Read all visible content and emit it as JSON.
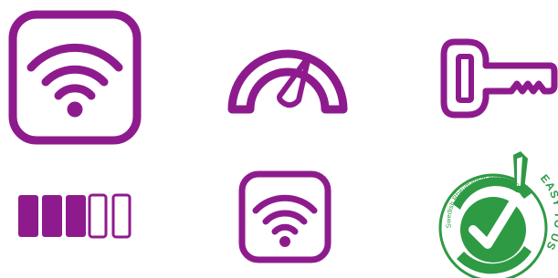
{
  "colors": {
    "primary": "#8e1b8e",
    "badge_green": "#2e9a44",
    "background": "#ffffff"
  },
  "icons": [
    {
      "name": "wifi-large-icon"
    },
    {
      "name": "speedometer-icon"
    },
    {
      "name": "key-icon"
    },
    {
      "name": "signal-bars-icon"
    },
    {
      "name": "wifi-small-icon"
    },
    {
      "name": "easy-to-use-badge"
    }
  ],
  "signal_bars": {
    "filled": 3,
    "total": 5
  },
  "badge": {
    "top_text": "EASY TO USE",
    "ring_text": "Swedish Rheumatism Association"
  }
}
